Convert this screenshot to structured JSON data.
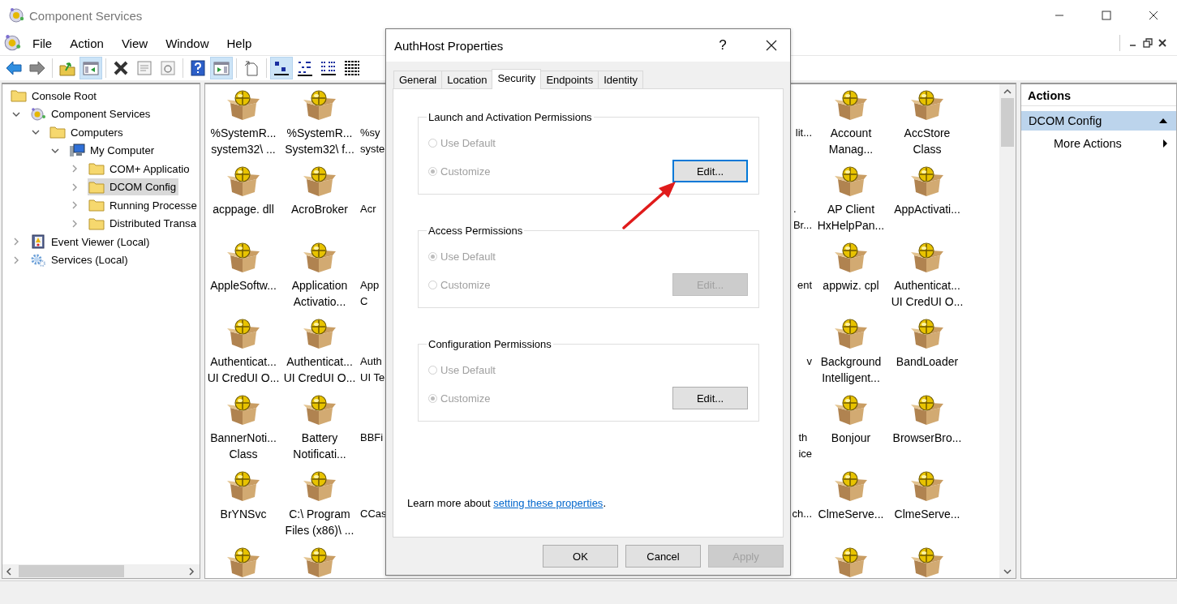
{
  "window": {
    "title": "Component Services"
  },
  "menu": [
    "File",
    "Action",
    "View",
    "Window",
    "Help"
  ],
  "toolbar": [
    [
      {
        "kind": "back",
        "pressed": false
      },
      {
        "kind": "forward",
        "pressed": false
      }
    ],
    [
      {
        "kind": "up-folder",
        "pressed": false
      },
      {
        "kind": "console-tree",
        "pressed": true
      }
    ],
    [
      {
        "kind": "delete",
        "pressed": false
      },
      {
        "kind": "properties",
        "pressed": false
      },
      {
        "kind": "refresh",
        "pressed": false
      }
    ],
    [
      {
        "kind": "help",
        "pressed": false
      },
      {
        "kind": "action-pane",
        "pressed": true
      }
    ],
    [
      {
        "kind": "export",
        "pressed": false
      }
    ],
    [
      {
        "kind": "large-icons",
        "pressed": true
      },
      {
        "kind": "small-icons",
        "pressed": false
      },
      {
        "kind": "list",
        "pressed": false
      },
      {
        "kind": "details",
        "pressed": false
      }
    ]
  ],
  "tree": [
    {
      "label": "Console Root",
      "kind": "folder",
      "selected": false,
      "children": [
        {
          "label": "Component Services",
          "kind": "component-services",
          "selected": false,
          "expanded": true,
          "children": [
            {
              "label": "Computers",
              "kind": "folder",
              "selected": false,
              "expanded": true,
              "children": [
                {
                  "label": "My Computer",
                  "kind": "computer",
                  "selected": false,
                  "expanded": true,
                  "children": [
                    {
                      "label": "COM+ Applicatio",
                      "kind": "folder",
                      "selected": false,
                      "expanded": false
                    },
                    {
                      "label": "DCOM Config",
                      "kind": "folder",
                      "selected": true,
                      "expanded": false
                    },
                    {
                      "label": "Running Processe",
                      "kind": "folder",
                      "selected": false,
                      "expanded": false
                    },
                    {
                      "label": "Distributed Transa",
                      "kind": "folder",
                      "selected": false,
                      "expanded": false
                    }
                  ]
                }
              ]
            }
          ]
        },
        {
          "label": "Event Viewer (Local)",
          "kind": "event-viewer",
          "selected": false,
          "expanded": false
        },
        {
          "label": "Services (Local)",
          "kind": "services",
          "selected": false,
          "expanded": false
        }
      ]
    }
  ],
  "icon_view": {
    "left_columns": [
      {
        "items": [
          {
            "kind": "component",
            "lines": [
              "%SystemR...",
              "system32\\ ..."
            ]
          },
          {
            "kind": "component",
            "lines": [
              "acppage. dll"
            ]
          },
          {
            "kind": "component",
            "lines": [
              "AppleSoftw..."
            ]
          },
          {
            "kind": "component",
            "lines": [
              "Authenticat...",
              "UI CredUI O..."
            ]
          },
          {
            "kind": "component",
            "lines": [
              "BannerNoti...",
              "Class"
            ]
          },
          {
            "kind": "component",
            "lines": [
              "BrYNSvc"
            ]
          },
          {
            "kind": "icon-only"
          }
        ]
      },
      {
        "items": [
          {
            "kind": "component",
            "lines": [
              "%SystemR...",
              "System32\\ f..."
            ]
          },
          {
            "kind": "component",
            "lines": [
              "AcroBroker"
            ]
          },
          {
            "kind": "component",
            "lines": [
              "Application",
              "Activatio..."
            ]
          },
          {
            "kind": "component",
            "lines": [
              "Authenticat...",
              "UI CredUI O..."
            ]
          },
          {
            "kind": "component",
            "lines": [
              "Battery",
              "Notificati..."
            ]
          },
          {
            "kind": "component",
            "lines": [
              "C:\\ Program",
              "Files (x86)\\ ..."
            ]
          },
          {
            "kind": "icon-only"
          }
        ]
      },
      {
        "items": [
          {
            "kind": "covered",
            "lines": [
              "%sy",
              "syste"
            ]
          },
          {
            "kind": "covered",
            "lines": [
              "Acr"
            ]
          },
          {
            "kind": "covered",
            "lines": [
              "App",
              "C"
            ]
          },
          {
            "kind": "covered",
            "lines": [
              "Auth",
              "UI Te"
            ]
          },
          {
            "kind": "covered",
            "lines": [
              "BBFi"
            ]
          },
          {
            "kind": "covered",
            "lines": [
              "CCas"
            ]
          }
        ]
      }
    ],
    "right_columns": [
      {
        "items": [
          {
            "kind": "covered",
            "lines": [
              "lit..."
            ]
          },
          {
            "kind": "covered",
            "lines": [
              ".",
              "Br..."
            ]
          },
          {
            "kind": "covered",
            "lines": [
              "ent"
            ]
          },
          {
            "kind": "covered",
            "lines": [
              "v"
            ]
          },
          {
            "kind": "covered",
            "lines": [
              "th",
              "ice"
            ]
          },
          {
            "kind": "covered",
            "lines": [
              "ch..."
            ]
          }
        ]
      },
      {
        "items": [
          {
            "kind": "component",
            "lines": [
              "Account",
              "Manag..."
            ]
          },
          {
            "kind": "component",
            "lines": [
              "AP Client",
              "HxHelpPan..."
            ]
          },
          {
            "kind": "component",
            "lines": [
              "appwiz. cpl"
            ]
          },
          {
            "kind": "component",
            "lines": [
              "Background",
              "Intelligent..."
            ]
          },
          {
            "kind": "component",
            "lines": [
              "Bonjour"
            ]
          },
          {
            "kind": "component",
            "lines": [
              "ClmeServe..."
            ]
          },
          {
            "kind": "icon-only"
          }
        ]
      },
      {
        "items": [
          {
            "kind": "component",
            "lines": [
              "AccStore",
              "Class"
            ]
          },
          {
            "kind": "component",
            "lines": [
              "AppActivati..."
            ]
          },
          {
            "kind": "component",
            "lines": [
              "Authenticat...",
              "UI CredUI O..."
            ]
          },
          {
            "kind": "component",
            "lines": [
              "BandLoader"
            ]
          },
          {
            "kind": "component",
            "lines": [
              "BrowserBro..."
            ]
          },
          {
            "kind": "component",
            "lines": [
              "ClmeServe..."
            ]
          },
          {
            "kind": "icon-only"
          }
        ]
      }
    ]
  },
  "actions": {
    "title": "Actions",
    "items": [
      {
        "label": "DCOM Config",
        "kind": "section",
        "selected": true
      },
      {
        "label": "More Actions",
        "kind": "submenu",
        "selected": false
      }
    ]
  },
  "dialog": {
    "title": "AuthHost Properties",
    "help_button": "?",
    "tabs": [
      {
        "label": "General",
        "selected": false
      },
      {
        "label": "Location",
        "selected": false
      },
      {
        "label": "Security",
        "selected": true
      },
      {
        "label": "Endpoints",
        "selected": false
      },
      {
        "label": "Identity",
        "selected": false
      }
    ],
    "groups": [
      {
        "title": "Launch and Activation Permissions",
        "options": [
          {
            "label": "Use Default",
            "checked": false,
            "disabled": true
          },
          {
            "label": "Customize",
            "checked": true,
            "disabled": true
          }
        ],
        "edit_button": {
          "label": "Edit...",
          "disabled": false,
          "focused": true
        }
      },
      {
        "title": "Access Permissions",
        "options": [
          {
            "label": "Use Default",
            "checked": true,
            "disabled": true
          },
          {
            "label": "Customize",
            "checked": false,
            "disabled": true
          }
        ],
        "edit_button": {
          "label": "Edit...",
          "disabled": true,
          "focused": false
        }
      },
      {
        "title": "Configuration Permissions",
        "options": [
          {
            "label": "Use Default",
            "checked": false,
            "disabled": true
          },
          {
            "label": "Customize",
            "checked": true,
            "disabled": true
          }
        ],
        "edit_button": {
          "label": "Edit...",
          "disabled": false,
          "focused": false
        }
      }
    ],
    "learn_more": {
      "before": "Learn more about ",
      "link": "setting these properties",
      "after": "."
    },
    "buttons": [
      {
        "label": "OK",
        "disabled": false
      },
      {
        "label": "Cancel",
        "disabled": false
      },
      {
        "label": "Apply",
        "disabled": true
      }
    ]
  }
}
